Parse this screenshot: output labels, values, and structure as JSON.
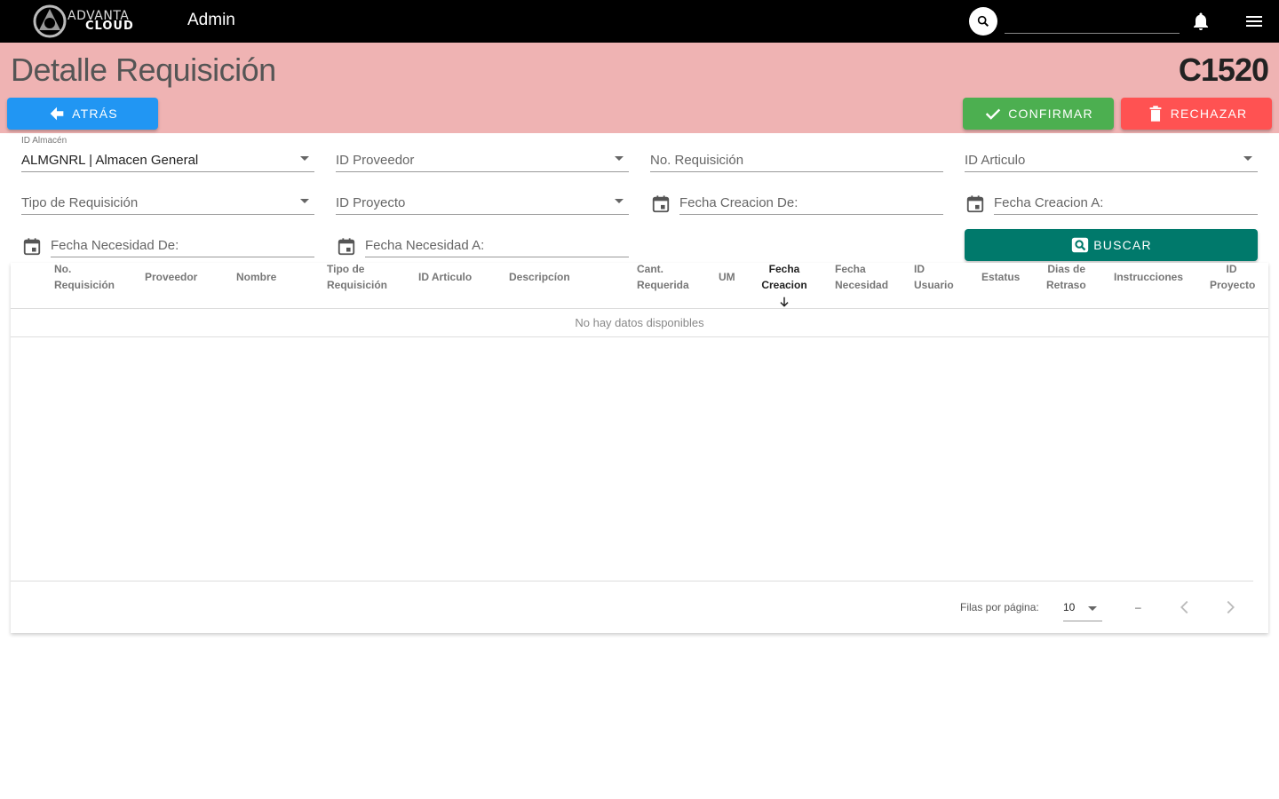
{
  "app": {
    "logo_line1": "ADVANTA",
    "logo_line2": "CLOUD",
    "title": "Admin",
    "search_placeholder": ""
  },
  "header": {
    "page_title": "Detalle Requisición",
    "req_code": "C1520",
    "back_label": "ATRÁS",
    "confirm_label": "CONFIRMAR",
    "reject_label": "RECHAZAR",
    "band_color": "#efb3b3"
  },
  "filters": {
    "almacen_label": "ID Almacén",
    "almacen_value": "ALMGNRL | Almacen General",
    "proveedor": "ID Proveedor",
    "no_requisicion": "No. Requisición",
    "articulo": "ID Articulo",
    "tipo": "Tipo de Requisición",
    "proyecto": "ID Proyecto",
    "fecha_creacion_de": "Fecha Creacion De:",
    "fecha_creacion_a": "Fecha Creacion A:",
    "fecha_necesidad_de": "Fecha Necesidad De:",
    "fecha_necesidad_a": "Fecha Necesidad A:",
    "search_label": "BUSCAR"
  },
  "table": {
    "columns": [
      [
        "No.",
        "Requisición"
      ],
      [
        "Proveedor"
      ],
      [
        "Nombre"
      ],
      [
        "Tipo de",
        "Requisición"
      ],
      [
        "ID Articulo"
      ],
      [
        "Descripcíon"
      ],
      [
        "Cant.",
        "Requerida"
      ],
      [
        "UM"
      ],
      [
        "Fecha",
        "Creacion"
      ],
      [
        "Fecha",
        "Necesidad"
      ],
      [
        "ID",
        "Usuario"
      ],
      [
        "Estatus"
      ],
      [
        "Dias de",
        "Retraso"
      ],
      [
        "Instrucciones"
      ],
      [
        "ID",
        "Proyecto"
      ]
    ],
    "sorted_column": "Fecha Creacion",
    "empty_text": "No hay datos disponibles",
    "rows_per_page_label": "Filas por página:",
    "rows_per_page": "10",
    "range": "–"
  },
  "colors": {
    "back": "#2196f3",
    "confirm": "#4caf50",
    "reject": "#ff5252",
    "search": "#00796b"
  }
}
